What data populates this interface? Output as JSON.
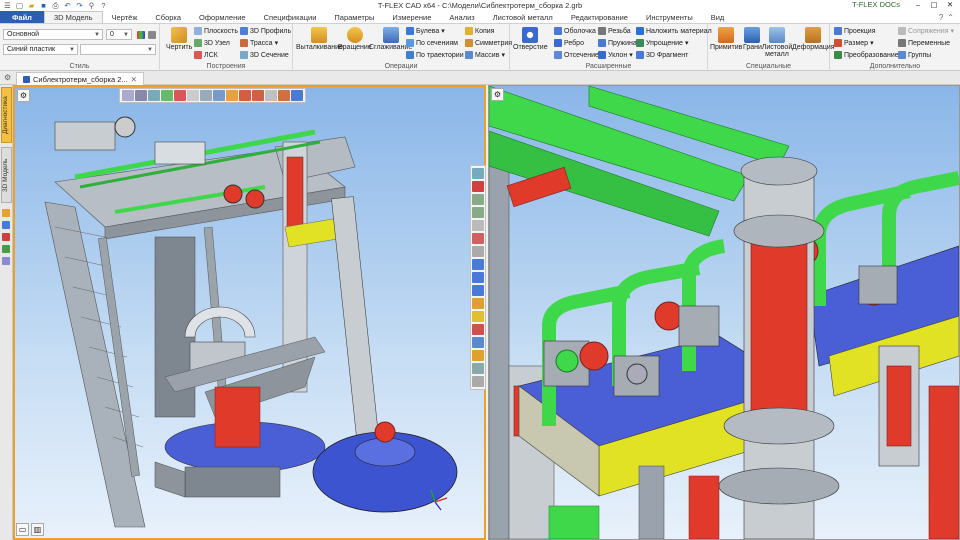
{
  "titlebar": {
    "title": "T-FLEX CAD x64 - C:\\Модели\\Сиблектротерм_сборка 2.grb",
    "docs_label": "T-FLEX DOCs"
  },
  "tabs": [
    {
      "label": "Файл"
    },
    {
      "label": "3D Модель"
    },
    {
      "label": "Чертёж"
    },
    {
      "label": "Сборка"
    },
    {
      "label": "Оформление"
    },
    {
      "label": "Спецификации"
    },
    {
      "label": "Параметры"
    },
    {
      "label": "Измерение"
    },
    {
      "label": "Анализ"
    },
    {
      "label": "Листовой металл"
    },
    {
      "label": "Редактирование"
    },
    {
      "label": "Инструменты"
    },
    {
      "label": "Вид"
    }
  ],
  "style_group": {
    "label": "Стиль",
    "layer_value": "Основной",
    "line_value": "0",
    "material_value": "Синий пластик"
  },
  "build_group": {
    "label": "Построения",
    "draw": "Чертить",
    "plane": "Плоскость",
    "node3d": "3D Узел",
    "lsk": "ЛСК",
    "profile3d": "3D Профиль",
    "path": "Трасса",
    "section3d": "3D Сечение"
  },
  "ops_group": {
    "label": "Операции",
    "extrude": "Выталкивание",
    "rotate": "Вращение",
    "smooth": "Сглаживание",
    "boolean": "Булева",
    "by_sections": "По сечениям",
    "by_path": "По траектории",
    "copy": "Копия",
    "symmetry": "Симметрия",
    "array": "Массив"
  },
  "ext_group": {
    "label": "Расширенные",
    "hole": "Отверстие",
    "shell": "Оболочка",
    "rib": "Ребро",
    "cut": "Отсечение",
    "thread": "Резьба",
    "spring": "Пружина",
    "slope": "Уклон",
    "apply_material": "Наложить материал",
    "simplify": "Упрощение",
    "fragment3d": "3D Фрагмент"
  },
  "special_group": {
    "label": "Специальные",
    "primitives": "Примитив",
    "faces": "Грани",
    "sheet_metal": "Листовой металл",
    "deformation": "Деформация"
  },
  "extra_group": {
    "label": "Дополнительно",
    "projection": "Проекция",
    "size": "Размер",
    "transform": "Преобразование",
    "mate": "Сопряжения",
    "variables": "Переменные",
    "groups": "Группы"
  },
  "doc_tab": {
    "label": "Сиблектротерм_сборка 2..."
  },
  "side_tabs": {
    "diagnostics": "Диагностика",
    "model3d": "3D Модель"
  },
  "colors": {
    "frame": "#9aa3ad",
    "blue_plate": "#4a5fd6",
    "yellow": "#e2e224",
    "red": "#e03a2a",
    "green": "#3fd84a",
    "accent_file_tab": "#2b5fb4",
    "active_border": "#f0a020"
  }
}
